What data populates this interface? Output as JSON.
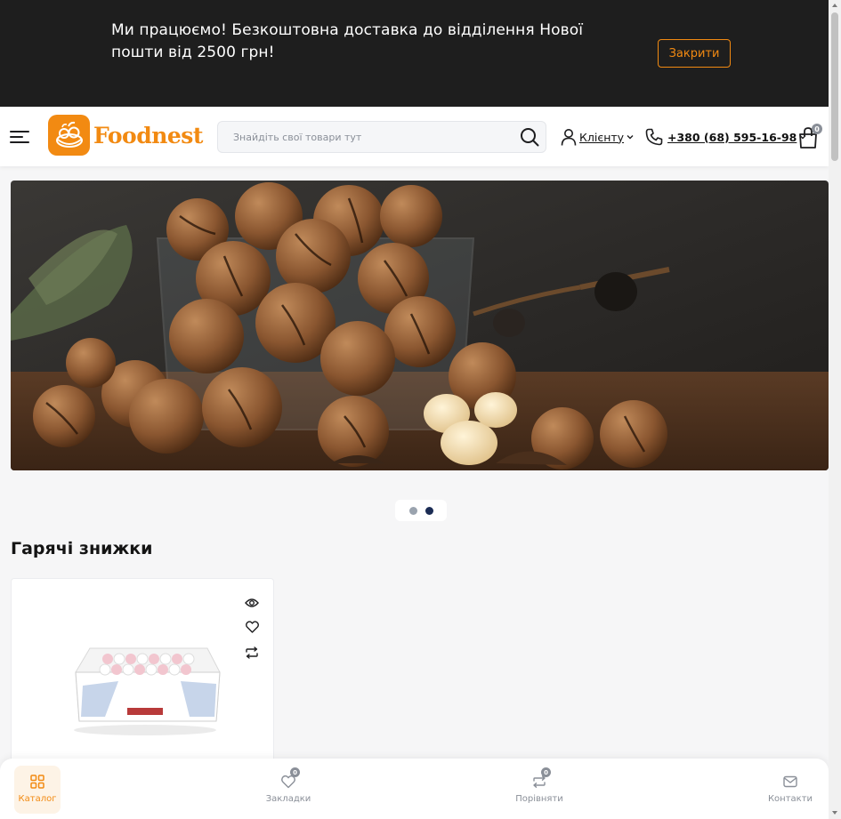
{
  "notice": {
    "text": "Ми працюємо! Безкоштовна доставка до відділення Нової пошти від 2500 грн!",
    "close_label": "Закрити",
    "accent": "#f28a12"
  },
  "header": {
    "logo_text": "Foodnest",
    "search_placeholder": "Знайдіть свої товари тут",
    "client_label": "Клієнту",
    "phone": "+380 (68) 595-16-98",
    "cart_count": "0"
  },
  "banner": {
    "slides_total": 2,
    "active_slide": 2
  },
  "hot_deals": {
    "title": "Гарячі знижки"
  },
  "bottom_nav": {
    "catalog_label": "Каталог",
    "bookmarks_label": "Закладки",
    "bookmarks_count": "0",
    "compare_label": "Порівняти",
    "compare_count": "0",
    "contacts_label": "Контакти"
  },
  "icons": [
    "menu-icon",
    "search-icon",
    "user-icon",
    "phone-icon",
    "cart-icon",
    "eye-icon",
    "heart-icon",
    "compare-icon",
    "grid-icon",
    "mail-icon"
  ]
}
